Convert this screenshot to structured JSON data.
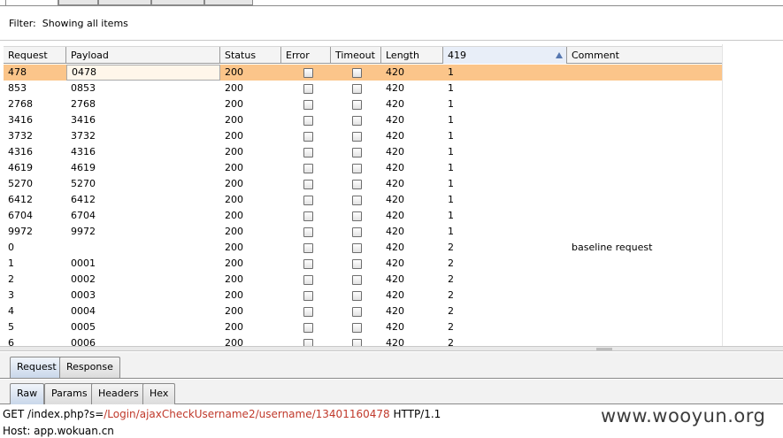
{
  "filter": {
    "label": "Filter:",
    "text": "Showing all items"
  },
  "table": {
    "columns": [
      "Request",
      "Payload",
      "Status",
      "Error",
      "Timeout",
      "Length",
      "419",
      "Comment"
    ],
    "sorted_column": "419",
    "rows": [
      {
        "request": "478",
        "payload": "0478",
        "status": "200",
        "length": "420",
        "col419": "1",
        "comment": ""
      },
      {
        "request": "853",
        "payload": "0853",
        "status": "200",
        "length": "420",
        "col419": "1",
        "comment": ""
      },
      {
        "request": "2768",
        "payload": "2768",
        "status": "200",
        "length": "420",
        "col419": "1",
        "comment": ""
      },
      {
        "request": "3416",
        "payload": "3416",
        "status": "200",
        "length": "420",
        "col419": "1",
        "comment": ""
      },
      {
        "request": "3732",
        "payload": "3732",
        "status": "200",
        "length": "420",
        "col419": "1",
        "comment": ""
      },
      {
        "request": "4316",
        "payload": "4316",
        "status": "200",
        "length": "420",
        "col419": "1",
        "comment": ""
      },
      {
        "request": "4619",
        "payload": "4619",
        "status": "200",
        "length": "420",
        "col419": "1",
        "comment": ""
      },
      {
        "request": "5270",
        "payload": "5270",
        "status": "200",
        "length": "420",
        "col419": "1",
        "comment": ""
      },
      {
        "request": "6412",
        "payload": "6412",
        "status": "200",
        "length": "420",
        "col419": "1",
        "comment": ""
      },
      {
        "request": "6704",
        "payload": "6704",
        "status": "200",
        "length": "420",
        "col419": "1",
        "comment": ""
      },
      {
        "request": "9972",
        "payload": "9972",
        "status": "200",
        "length": "420",
        "col419": "1",
        "comment": ""
      },
      {
        "request": "0",
        "payload": "",
        "status": "200",
        "length": "420",
        "col419": "2",
        "comment": "baseline request"
      },
      {
        "request": "1",
        "payload": "0001",
        "status": "200",
        "length": "420",
        "col419": "2",
        "comment": ""
      },
      {
        "request": "2",
        "payload": "0002",
        "status": "200",
        "length": "420",
        "col419": "2",
        "comment": ""
      },
      {
        "request": "3",
        "payload": "0003",
        "status": "200",
        "length": "420",
        "col419": "2",
        "comment": ""
      },
      {
        "request": "4",
        "payload": "0004",
        "status": "200",
        "length": "420",
        "col419": "2",
        "comment": ""
      },
      {
        "request": "5",
        "payload": "0005",
        "status": "200",
        "length": "420",
        "col419": "2",
        "comment": ""
      },
      {
        "request": "6",
        "payload": "0006",
        "status": "200",
        "length": "420",
        "col419": "2",
        "comment": ""
      }
    ]
  },
  "detail_tabs": [
    "Request",
    "Response"
  ],
  "view_tabs": [
    "Raw",
    "Params",
    "Headers",
    "Hex"
  ],
  "request": {
    "line1_method": "GET",
    "line1_path": "/index.php?s=",
    "line1_highlight": "/Login/ajaxCheckUsername2/username/13401160478",
    "line1_version": "HTTP/1.1",
    "line2": "Host: app.wokuan.cn"
  },
  "watermark": "www.wooyun.org",
  "colors": {
    "selected_row": "#fbc58a",
    "highlight_text": "#c0392b"
  }
}
